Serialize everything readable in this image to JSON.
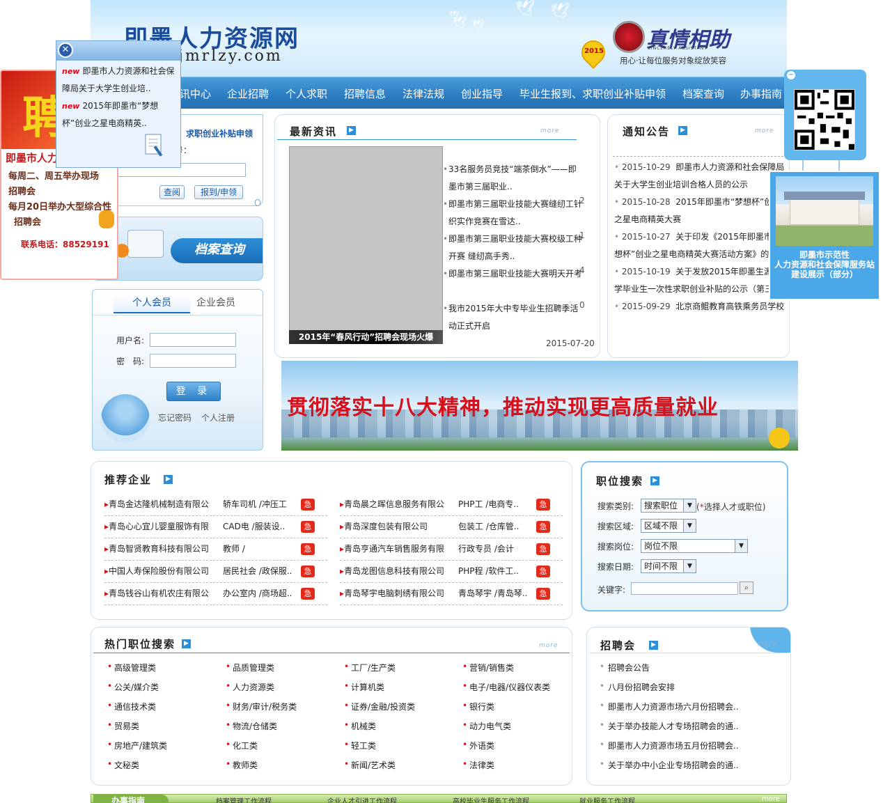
{
  "header": {
    "site_title": "即墨人力资源网",
    "site_url": "jmrlzy.com",
    "year_badge": "2015",
    "brand_name": "真情相助",
    "brand_sub": "SINCERELY ASSISTANT",
    "brand_mark": "",
    "slogan": "用心·让每位服务对象绽放笑容"
  },
  "nav": {
    "items": [
      "讯中心",
      "企业招聘",
      "个人求职",
      "招聘信息",
      "法律法规",
      "创业指导",
      "毕业生报到、求职创业补贴申领",
      "档案查询",
      "办事指南"
    ]
  },
  "ad_left": {
    "title": "即墨市人力",
    "line1": "每周二、周五举办现场",
    "line2": "招聘会",
    "line3": "每月20日举办大型综合性",
    "line4": "招聘会",
    "phone": "联系电话：88529191",
    "big_char": "聘"
  },
  "popup": {
    "new_tag": "new",
    "item1": "即墨市人力资源和社会保障局关于大学生创业培..",
    "item2": "2015年即墨市“梦想杯”创业之星电商精英..",
    "close_icon": "close-icon"
  },
  "subsidy": {
    "title": "求职创业补贴申领",
    "partial_label": "号：",
    "query_button": "查阅",
    "apply_button": "报到/申领"
  },
  "archive": {
    "label": "档案查询"
  },
  "login": {
    "tab_personal": "个人会员",
    "tab_company": "企业会员",
    "username_label": "用户名:",
    "password_label": "密　码:",
    "login_button": "登 录",
    "forgot": "忘记密码",
    "register": "个人注册"
  },
  "news": {
    "title": "最新资讯",
    "more": "more",
    "image_caption": "2015年“春风行动”招聘会现场火爆",
    "items": [
      "33名服务员竞技“端茶倒水”——即墨市第三届职业..",
      "即墨市第三届职业技能大赛缝纫工针织实作竞赛在雪达..",
      "即墨市第三届职业技能大赛校级工种开赛 缝纫高手秀..",
      "即墨市第三届职业技能大赛明天开考",
      "我市2015年大中专毕业生招聘季活动正式开启"
    ],
    "overlap_nums": [
      "",
      "2",
      "1",
      "4",
      "0"
    ],
    "date": "2015-07-20"
  },
  "notice": {
    "title": "通知公告",
    "more": "more",
    "items": [
      {
        "date": "2015-10-29",
        "text": "即墨市人力资源和社会保障局关于大学生创业培训合格人员的公示"
      },
      {
        "date": "2015-10-28",
        "text": "2015年即墨市“梦想杯”创业之星电商精英大赛"
      },
      {
        "date": "2015-10-27",
        "text": "关于印发《2015年即墨市“梦想杯”创业之星电商精英大赛活动方案》的通知"
      },
      {
        "date": "2015-10-19",
        "text": "关于发放2015年即墨生源大学毕业生一次性求职创业补贴的公示（第三批）"
      },
      {
        "date": "2015-09-29",
        "text": "北京商鲲教育高铁乘务员学校招生简章"
      }
    ]
  },
  "qr": {
    "close": "−"
  },
  "demo": {
    "line1": "即墨市示范性",
    "line2": "人力资源和社会保障服务站",
    "line3": "建设展示（部分）"
  },
  "banner": {
    "text": "贯彻落实十八大精神，推动实现更高质量就业"
  },
  "recommend": {
    "title": "推荐企业",
    "urgent": "急",
    "left": [
      {
        "company": "青岛金达隆机械制造有限公",
        "jobs": "轿车司机 /冲压工"
      },
      {
        "company": "青岛心心宜儿婴童服饰有限",
        "jobs": "CAD电 /服装设.."
      },
      {
        "company": "青岛智贤教育科技有限公司",
        "jobs": "教师 /"
      },
      {
        "company": "中国人寿保险股份有限公司",
        "jobs": "居民社会 /政保服.."
      },
      {
        "company": "青岛钱谷山有机农庄有限公",
        "jobs": "办公室内 /商场超.."
      }
    ],
    "right": [
      {
        "company": "青岛晨之晖信息服务有限公",
        "jobs": "PHP工 /电商专.."
      },
      {
        "company": "青岛深度包装有限公司",
        "jobs": "包装工 /仓库管.."
      },
      {
        "company": "青岛亨通汽车销售服务有限",
        "jobs": "行政专员 /会计"
      },
      {
        "company": "青岛龙图信息科技有限公司",
        "jobs": "PHP程 /软件工.."
      },
      {
        "company": "青岛琴宇电脑刺绣有限公司",
        "jobs": "青岛琴宇 /青岛琴.."
      }
    ]
  },
  "job_search": {
    "title": "职位搜索",
    "category_label": "搜索类别:",
    "category_value": "搜索职位",
    "category_hint": "选择人才或职位)",
    "hint_prefix": "(",
    "hint_star": "*",
    "area_label": "搜索区域:",
    "area_value": "区域不限",
    "position_label": "搜索岗位:",
    "position_value": "岗位不限",
    "date_label": "搜索日期:",
    "date_value": "时间不限",
    "keyword_label": "关键字:"
  },
  "hot_jobs": {
    "title": "热门职位搜索",
    "more": "more",
    "items": [
      "高级管理类",
      "品质管理类",
      "工厂/生产类",
      "营销/销售类",
      "公关/媒介类",
      "人力资源类",
      "计算机类",
      "电子/电器/仪器仪表类",
      "通信技术类",
      "财务/审计/税务类",
      "证券/金融/投资类",
      "银行类",
      "贸易类",
      "物流/仓储类",
      "机械类",
      "动力电气类",
      "房地产/建筑类",
      "化工类",
      "轻工类",
      "外语类",
      "文秘类",
      "教师类",
      "新闻/艺术类",
      "法律类"
    ]
  },
  "job_fair": {
    "title": "招聘会",
    "more": "more",
    "items": [
      "招聘会公告",
      "八月份招聘会安排",
      "即墨市人力资源市场六月份招聘会..",
      "关于举办技能人才专场招聘会的通..",
      "即墨市人力资源市场五月份招聘会..",
      "关于举办中小企业专场招聘会的通.."
    ]
  },
  "bottom": {
    "label": "办事指南",
    "links": [
      "档案管理工作流程",
      "企业人才引进工作流程",
      "高校毕业生服务工作流程",
      "就业服务工作流程"
    ],
    "more": "more"
  }
}
